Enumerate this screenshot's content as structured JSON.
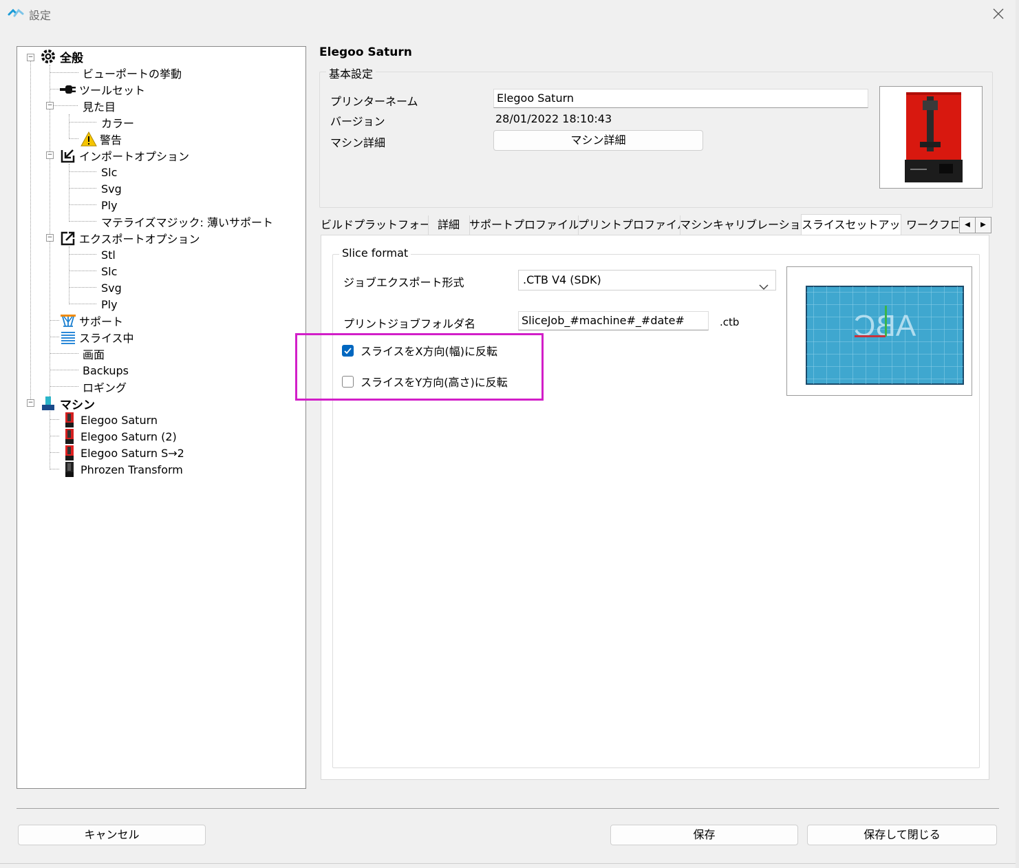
{
  "window": {
    "title": "設定"
  },
  "tree": {
    "general": "全般",
    "viewport": "ビューポートの挙動",
    "toolset": "ツールセット",
    "appearance": "見た目",
    "color": "カラー",
    "warning": "警告",
    "import_options": "インポートオプション",
    "import_slc": "Slc",
    "import_svg": "Svg",
    "import_ply": "Ply",
    "materialise_magics": "マテライズマジック: 薄いサポート",
    "export_options": "エクスポートオプション",
    "export_stl": "Stl",
    "export_slc": "Slc",
    "export_svg": "Svg",
    "export_ply": "Ply",
    "support": "サポート",
    "slicing": "スライス中",
    "screen": "画面",
    "backups": "Backups",
    "logging": "ロギング",
    "machine": "マシン",
    "machine_1": "Elegoo Saturn",
    "machine_2": "Elegoo Saturn (2)",
    "machine_3": "Elegoo Saturn S→2",
    "machine_4": "Phrozen Transform"
  },
  "main": {
    "machine_title": "Elegoo Saturn",
    "basic": {
      "legend": "基本設定",
      "printer_name_label": "プリンターネーム",
      "printer_name_value": "Elegoo Saturn",
      "version_label": "バージョン",
      "version_value": "28/01/2022 18:10:43",
      "machine_detail_label": "マシン詳細",
      "machine_detail_button": "マシン詳細"
    },
    "tabs": [
      "ビルドプラットフォーム",
      "詳細",
      "サポートプロファイル",
      "プリントプロファイル",
      "マシンキャリブレーション",
      "スライスセットアップ",
      "ワークフロー"
    ],
    "slice": {
      "legend": "Slice format",
      "job_export_label": "ジョブエクスポート形式",
      "job_export_value": ".CTB V4 (SDK)",
      "folder_label": "プリントジョブフォルダ名",
      "folder_value": "SliceJob_#machine#_#date#",
      "folder_ext": ".ctb",
      "flip_x_label": "スライスをX方向(幅)に反転",
      "flip_y_label": "スライスをY方向(高さ)に反転",
      "flip_x_checked": true,
      "flip_y_checked": false,
      "preview_text": "ABC"
    }
  },
  "footer": {
    "cancel": "キャンセル",
    "save": "保存",
    "save_close": "保存して閉じる"
  },
  "colors": {
    "accent": "#0067c0",
    "highlight": "#d21ec8",
    "preview_bg": "#3fa7cf"
  }
}
